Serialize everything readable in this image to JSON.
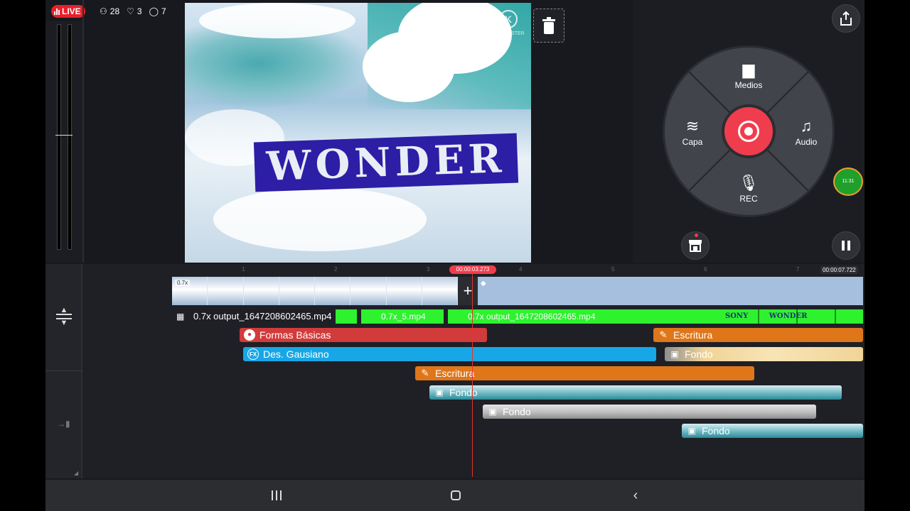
{
  "status": {
    "live_label": "LIVE",
    "viewers": "28",
    "likes": "3",
    "comments": "7",
    "live_color": "#e8202a"
  },
  "preview": {
    "title_text": "WONDER",
    "watermark": "KINEMASTER"
  },
  "wheel": {
    "media": "Medios",
    "layer": "Capa",
    "audio": "Audio",
    "rec": "REC",
    "record_color": "#f03d4d"
  },
  "floating_badge": {
    "time": "11:31"
  },
  "timeline": {
    "current_time": "00:00:03.273",
    "end_time": "00:00:07.722",
    "ruler_marks": [
      "1",
      "2",
      "3",
      "4",
      "5",
      "6",
      "7"
    ],
    "video_speed": "0.7x",
    "layer_clips": [
      "0.7x output_1647208602465.mp4",
      "0.7x_5.mp4",
      "0.7x output_1647208602465.mp4"
    ],
    "sony_label": "SONY WONDER",
    "layers": {
      "formas": "Formas Básicas",
      "escritura_top": "Escritura",
      "des_gausiano": "Des. Gausiano",
      "fondo_sand": "Fondo",
      "escritura": "Escritura",
      "fondo_teal": "Fondo",
      "fondo_gray": "Fondo",
      "fondo_teal2": "Fondo"
    }
  },
  "icons": {
    "trash": "trash-icon",
    "share": "share-icon",
    "store": "asset-store-icon",
    "pause": "pause-icon"
  }
}
